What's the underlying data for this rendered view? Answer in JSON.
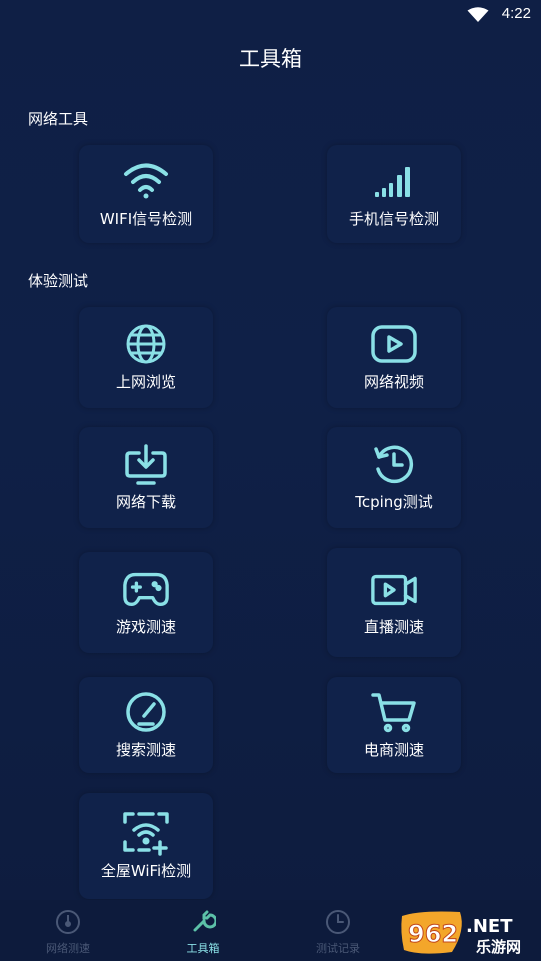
{
  "status_bar": {
    "time": "4:22"
  },
  "page_title": "工具箱",
  "sections": [
    {
      "title": "网络工具"
    },
    {
      "title": "体验测试"
    }
  ],
  "tools": {
    "wifi_signal": {
      "label": "WIFI信号检测",
      "icon": "wifi-icon"
    },
    "phone_signal": {
      "label": "手机信号检测",
      "icon": "signal-bars-icon"
    },
    "web_browse": {
      "label": "上网浏览",
      "icon": "globe-icon"
    },
    "net_video": {
      "label": "网络视频",
      "icon": "play-icon"
    },
    "net_download": {
      "label": "网络下载",
      "icon": "download-icon"
    },
    "tcping": {
      "label": "Tcping测试",
      "icon": "history-clock-icon"
    },
    "game_speed": {
      "label": "游戏测速",
      "icon": "gamepad-icon"
    },
    "live_speed": {
      "label": "直播测速",
      "icon": "video-camera-icon"
    },
    "search_speed": {
      "label": "搜索测速",
      "icon": "speedometer-icon"
    },
    "ecommerce_speed": {
      "label": "电商测速",
      "icon": "cart-icon"
    },
    "whole_house_wifi": {
      "label": "全屋WiFi检测",
      "icon": "wifi-scan-icon"
    }
  },
  "bottom_nav": {
    "items": [
      {
        "label": "网络测速",
        "icon": "speed-test-icon",
        "active": false
      },
      {
        "label": "工具箱",
        "icon": "wrench-icon",
        "active": true
      },
      {
        "label": "测试记录",
        "icon": "clock-icon",
        "active": false
      }
    ]
  },
  "watermark": {
    "logo": "962",
    "suffix": ".NET",
    "sub": "乐游网"
  },
  "colors": {
    "accent": "#8ae0e6",
    "background": "#0f1f45",
    "tile": "#10224a"
  }
}
